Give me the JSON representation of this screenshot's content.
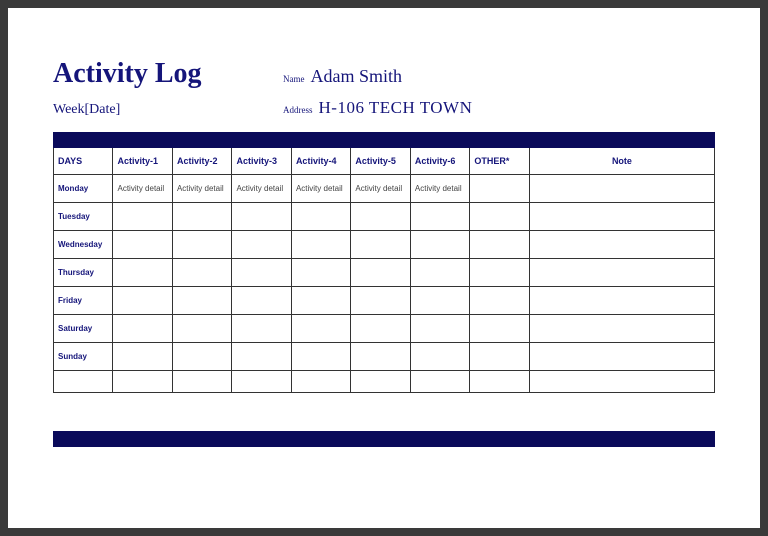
{
  "header": {
    "title": "Activity Log",
    "name_label": "Name",
    "name_value": "Adam Smith",
    "week_label": "Week[Date]",
    "address_label": "Address",
    "address_value": "H-106 TECH TOWN"
  },
  "table": {
    "columns": [
      "DAYS",
      "Activity-1",
      "Activity-2",
      "Activity-3",
      "Activity-4",
      "Activity-5",
      "Activity-6",
      "OTHER*",
      "Note"
    ],
    "rows": [
      {
        "day": "Monday",
        "cells": [
          "Activity detail",
          "Activity detail",
          "Activity detail",
          "Activity detail",
          "Activity detail",
          "Activity detail",
          "",
          ""
        ]
      },
      {
        "day": "Tuesday",
        "cells": [
          "",
          "",
          "",
          "",
          "",
          "",
          "",
          ""
        ]
      },
      {
        "day": "Wednesday",
        "cells": [
          "",
          "",
          "",
          "",
          "",
          "",
          "",
          ""
        ]
      },
      {
        "day": "Thursday",
        "cells": [
          "",
          "",
          "",
          "",
          "",
          "",
          "",
          ""
        ]
      },
      {
        "day": "Friday",
        "cells": [
          "",
          "",
          "",
          "",
          "",
          "",
          "",
          ""
        ]
      },
      {
        "day": "Saturday",
        "cells": [
          "",
          "",
          "",
          "",
          "",
          "",
          "",
          ""
        ]
      },
      {
        "day": "Sunday",
        "cells": [
          "",
          "",
          "",
          "",
          "",
          "",
          "",
          ""
        ]
      }
    ]
  }
}
